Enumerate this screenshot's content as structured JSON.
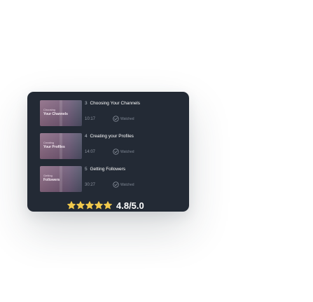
{
  "lessons": [
    {
      "number": "3",
      "title": "Choosing Your Channels",
      "duration": "10:17",
      "status": "Watched",
      "thumb_small": "Choosing",
      "thumb_big": "Your Channels",
      "thumb_icon": "watched-check-icon"
    },
    {
      "number": "4",
      "title": "Creating your Profiles",
      "duration": "14:07",
      "status": "Watched",
      "thumb_small": "Creating",
      "thumb_big": "Your Profiles",
      "thumb_icon": "watched-check-icon"
    },
    {
      "number": "5",
      "title": "Getting Followers",
      "duration": "30:27",
      "status": "Watched",
      "thumb_small": "Getting",
      "thumb_big": "Followers",
      "thumb_icon": "watched-check-icon"
    }
  ],
  "rating": {
    "value": 4.8,
    "max": 5,
    "label": "4.8/5.0",
    "star_color": "#f2c94c",
    "star_empty_color": "#f2c94c"
  },
  "colors": {
    "card_bg": "#232a35",
    "text_primary": "#ffffff",
    "text_muted": "#8c939f",
    "thumb_gradient": [
      "#8c6a84",
      "#6c5a78",
      "#4f5268"
    ]
  }
}
